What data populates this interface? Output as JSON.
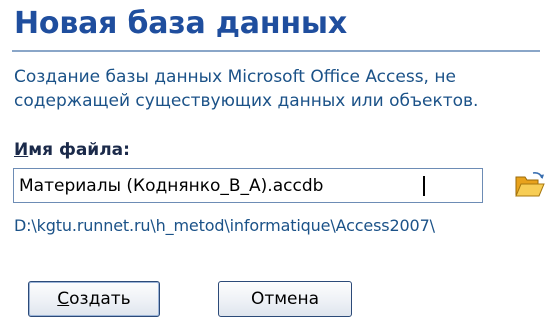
{
  "dialog": {
    "title": "Новая база данных",
    "description": "Создание базы данных Microsoft Office Access, не содержащей существующих данных или объектов.",
    "file_label": {
      "accel": "И",
      "rest": "мя файла:"
    },
    "file_name": "Материалы (Коднянко_В_А).accdb",
    "path": "D:\\kgtu.runnet.ru\\h_metod\\informatique\\Access2007\\",
    "create_button": {
      "accel": "С",
      "rest": "оздать"
    },
    "cancel_button": "Отмена"
  },
  "icons": {
    "browse": "open-folder-icon"
  },
  "colors": {
    "title": "#1f4e9e",
    "text": "#1b5288",
    "folder": "#f0b429"
  }
}
